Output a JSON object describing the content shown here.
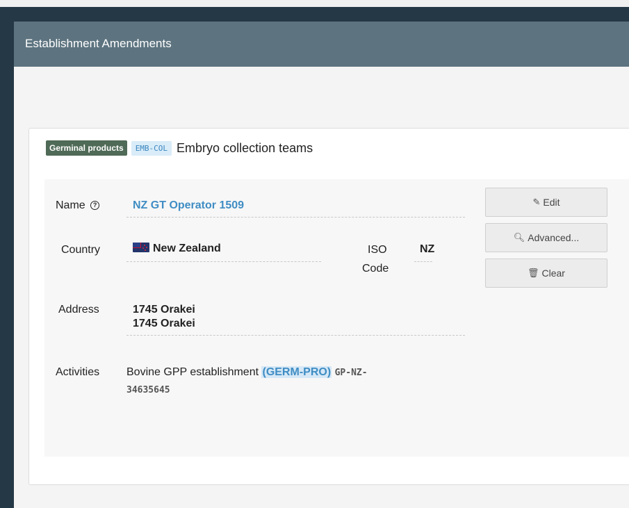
{
  "panel": {
    "title": "Establishment Amendments"
  },
  "card": {
    "badge_category": "Germinal products",
    "badge_code": "EMB-COL",
    "title": "Embryo collection teams"
  },
  "fields": {
    "name_label": "Name",
    "name_value": "NZ GT Operator 1509",
    "country_label": "Country",
    "country_value": "New Zealand",
    "iso_label_1": "ISO",
    "iso_label_2": "Code",
    "iso_value": "NZ",
    "address_label": "Address",
    "address_line1": "1745 Orakei",
    "address_line2": "1745 Orakei",
    "activities_label": "Activities",
    "activities_text": "Bovine GPP establishment",
    "activities_code": "(GERM-PRO)",
    "activities_id_1": "GP-NZ-",
    "activities_id_2": "34635645"
  },
  "buttons": {
    "edit": "Edit",
    "advanced": "Advanced...",
    "clear": "Clear"
  },
  "icons": {
    "help": "question-circle-icon",
    "flag": "new-zealand-flag-icon",
    "edit": "edit-icon",
    "search": "search-icon",
    "trash": "trash-icon"
  }
}
